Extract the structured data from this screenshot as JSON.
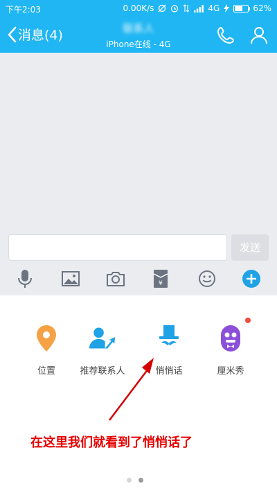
{
  "status_bar": {
    "time": "下午2:03",
    "speed": "0.00K/s",
    "network": "4G",
    "battery": "62%",
    "battery_level": 0.62
  },
  "header": {
    "back_label": "消息(4)",
    "contact_name": "联系人",
    "contact_status": "iPhone在线 - 4G",
    "phone_icon": "phone-icon",
    "profile_icon": "person-icon"
  },
  "composer": {
    "input_value": "",
    "send_label": "发送",
    "toolbar": [
      "mic-icon",
      "image-icon",
      "camera-icon",
      "red-packet-icon",
      "emoji-icon",
      "plus-icon"
    ]
  },
  "apps": [
    {
      "label": "位置",
      "icon": "location-pin-icon",
      "color": "#f5a246"
    },
    {
      "label": "推荐联系人",
      "icon": "share-contact-icon",
      "color": "#1fa2e6"
    },
    {
      "label": "悄悄话",
      "icon": "top-hat-mustache-icon",
      "color": "#1fa2e6"
    },
    {
      "label": "厘米秀",
      "icon": "cmshow-icon",
      "color": "#8c4fd9",
      "badge": true
    }
  ],
  "annotation": "在这里我们就看到了悄悄话了",
  "pager": {
    "pages": 2,
    "active": 2
  }
}
